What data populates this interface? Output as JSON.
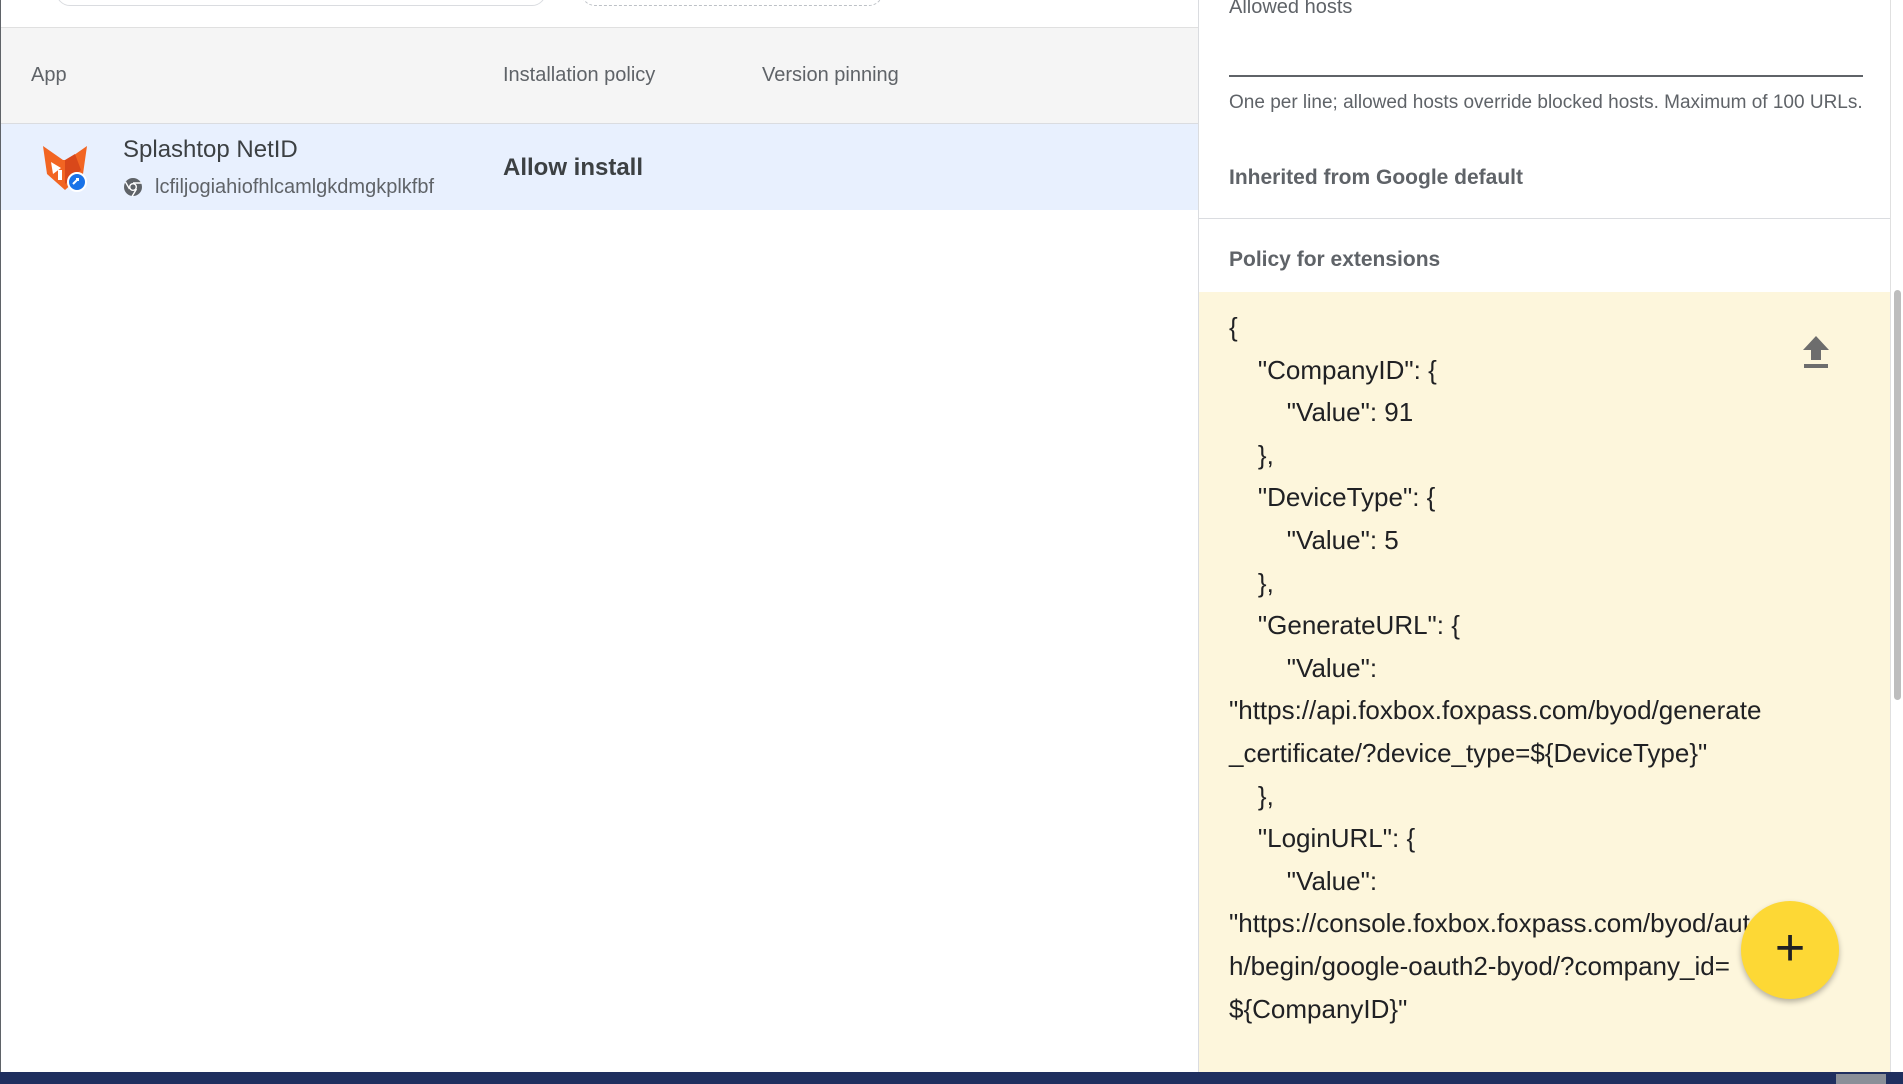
{
  "table": {
    "headers": {
      "app": "App",
      "installation_policy": "Installation policy",
      "version_pinning": "Version pinning"
    },
    "rows": [
      {
        "name": "Splashtop NetID",
        "id": "lcfiljogiahiofhlcamlgkdmgkplkfbf",
        "policy": "Allow install",
        "icon": "splashtop-fox-icon"
      }
    ]
  },
  "panel": {
    "allowed_hosts_label": "Allowed hosts",
    "allowed_hosts_value": "",
    "helper_text": "One per line; allowed hosts override blocked hosts. Maximum of 100 URLs.",
    "inherited_text": "Inherited from Google default",
    "policy_label": "Policy for extensions",
    "policy_json": "{\n    \"CompanyID\": {\n        \"Value\": 91\n    },\n    \"DeviceType\": {\n        \"Value\": 5\n    },\n    \"GenerateURL\": {\n        \"Value\": \n\"https://api.foxbox.foxpass.com/byod/generate_certificate/?device_type=${DeviceType}\"\n    },\n    \"LoginURL\": {\n        \"Value\": \n\"https://console.foxbox.foxpass.com/byod/auth/begin/google-oauth2-byod/?company_id=${CompanyID}\"",
    "upload_icon": "upload-icon"
  },
  "fab": {
    "label": "+",
    "color": "#fdd835"
  },
  "colors": {
    "selected_row": "#e8f0fe",
    "json_bg": "#fdf6dc",
    "bottom_bar": "#1f2f5f"
  }
}
